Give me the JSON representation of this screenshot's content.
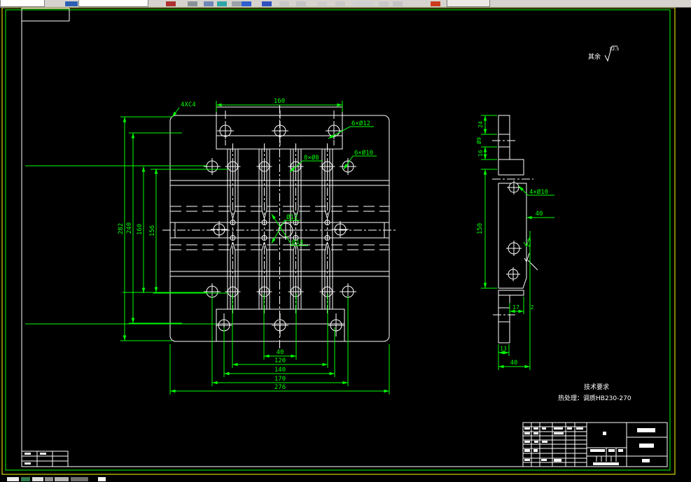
{
  "surface_note": {
    "prefix": "其余",
    "value": "12.5"
  },
  "tech_requirements": {
    "title": "技术要求",
    "line": "热处理：调质HB230-270"
  },
  "front": {
    "dim_top": "160",
    "dims_left": [
      "282",
      "240",
      "160",
      "156"
    ],
    "dims_bottom": [
      "40",
      "120",
      "140",
      "170",
      "276"
    ],
    "labels": {
      "chamfer": "4XC4",
      "cbore": "6×Ø12",
      "drill10": "6×Ø10",
      "drill8": "8×Ø8",
      "center_a": "Ø12",
      "center_b": "Ø14"
    }
  },
  "side": {
    "dims_left_top": [
      "24",
      "Ø9",
      "16"
    ],
    "dim_left": "150",
    "label_holes": "4×Ø10",
    "dim_width": "40",
    "dim_17": "17",
    "dim_2": "2",
    "dim_13": "13",
    "dim_bottom": "40",
    "roughness": "6.3"
  }
}
